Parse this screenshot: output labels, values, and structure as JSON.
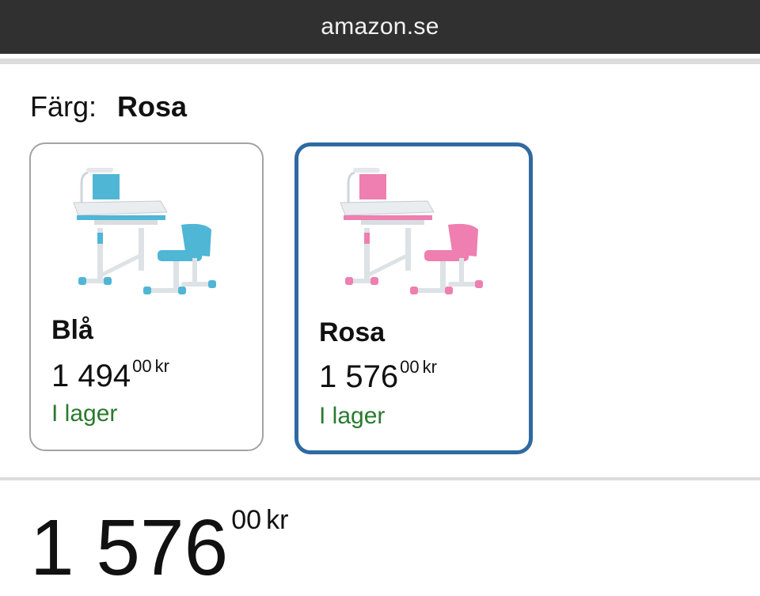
{
  "browser": {
    "url": "amazon.se"
  },
  "variation": {
    "label": "Färg:",
    "selected": "Rosa"
  },
  "swatches": [
    {
      "name": "Blå",
      "price_whole": "1 494",
      "price_fraction": "00",
      "currency": "kr",
      "availability": "I lager",
      "image": "blue-desk-chair-image",
      "selected": false,
      "color": "#4fb6d6"
    },
    {
      "name": "Rosa",
      "price_whole": "1 576",
      "price_fraction": "00",
      "currency": "kr",
      "availability": "I lager",
      "image": "pink-desk-chair-image",
      "selected": true,
      "color": "#ee7fb0"
    }
  ],
  "price": {
    "whole": "1 576",
    "fraction": "00",
    "currency": "kr"
  },
  "colors": {
    "selected_border": "#2f6aa1",
    "in_stock": "#2a7a2e",
    "address_bar": "#303030"
  }
}
